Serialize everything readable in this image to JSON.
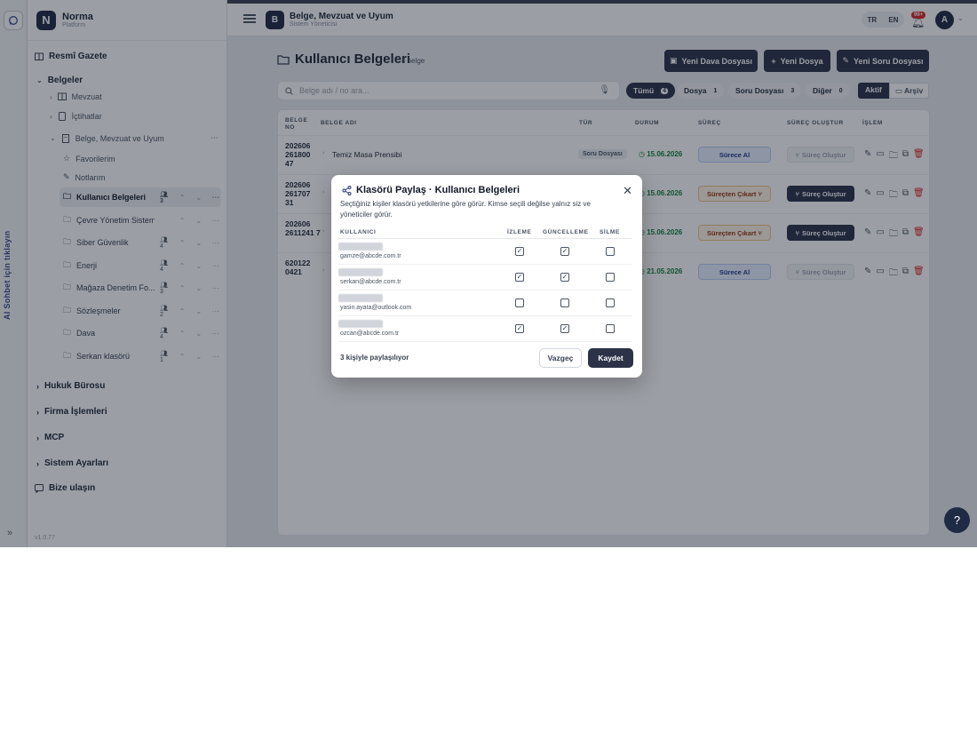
{
  "rail": {
    "vertical_label": "AI Sohbet için tıklayın"
  },
  "brand": {
    "logo": "N",
    "name": "Norma",
    "sub": "Platform"
  },
  "sidebar": {
    "resmi_gazete": "Resmî Gazete",
    "belgeler": "Belgeler",
    "sub_items": [
      {
        "label": "Mevzuat",
        "icon": "book-icon"
      },
      {
        "label": "İçtihatlar",
        "icon": "doc-icon"
      },
      {
        "label": "Belge, Mevzuat ve Uyum",
        "icon": "building-icon"
      }
    ],
    "favorilerim": "Favorilerim",
    "notlarim": "Notlarım",
    "folders": [
      {
        "name": "Kullanıcı Belgeleri",
        "count": "3"
      },
      {
        "name": "Çevre Yönetim Sistemleri",
        "count": ""
      },
      {
        "name": "Siber Güvenlik",
        "count": "4"
      },
      {
        "name": "Enerji",
        "count": "4"
      },
      {
        "name": "Mağaza Denetim Fo...",
        "count": "3"
      },
      {
        "name": "Sözleşmeler",
        "count": "2"
      },
      {
        "name": "Dava",
        "count": "4"
      },
      {
        "name": "Serkan klasörü",
        "count": "1"
      }
    ],
    "sections": [
      "Hukuk Bürosu",
      "Firma İşlemleri",
      "MCP",
      "Sistem Ayarları"
    ],
    "bize_ulasin": "Bize ulaşın",
    "version": "v1.0.77"
  },
  "topbar": {
    "badge": "B",
    "title": "Belge, Mevzuat ve Uyum",
    "subtitle": "Sistem Yöneticisi",
    "lang_tr": "TR",
    "lang_en": "EN",
    "notif_count": "99+",
    "avatar": "A"
  },
  "main": {
    "title": "Kullanıcı Belgeleri",
    "count": "4 belge",
    "btn_dava": "Yeni Dava Dosyası",
    "btn_dosya": "Yeni Dosya",
    "btn_soru": "Yeni Soru Dosyası",
    "search_placeholder": "Belge adı / no ara...",
    "chips": [
      {
        "label": "Tümü",
        "num": "4"
      },
      {
        "label": "Dosya",
        "num": "1"
      },
      {
        "label": "Soru Dosyası",
        "num": "3"
      },
      {
        "label": "Diğer",
        "num": "0"
      }
    ],
    "seg_aktif": "Aktif",
    "seg_arsiv": "Arşiv"
  },
  "table": {
    "headers": {
      "no": "BELGE NO",
      "ad": "BELGE ADI",
      "tur": "TÜR",
      "durum": "DURUM",
      "surec": "SÜREÇ",
      "olustur": "SÜREÇ OLUŞTUR",
      "islem": "İŞLEM"
    },
    "rows": [
      {
        "no": "202606 261800 47",
        "name": "Temiz Masa Prensibi",
        "type": "Soru Dosyası",
        "date": "15.06.2026",
        "surec": "Sürece Al",
        "olustur": "Süreç Oluştur"
      },
      {
        "no": "202606 261707 31",
        "name": "",
        "type": "",
        "date": "15.06.2026",
        "surec": "Süreçten Çıkart",
        "olustur": "Süreç Oluştur"
      },
      {
        "no": "202606 2611241 7",
        "name": "",
        "type": "",
        "date": "15.06.2026",
        "surec": "Süreçten Çıkart",
        "olustur": "Süreç Oluştur"
      },
      {
        "no": "620122 0421",
        "name": "",
        "type": "",
        "date": "21.05.2026",
        "surec": "Sürece Al",
        "olustur": "Süreç Oluştur"
      }
    ]
  },
  "modal": {
    "title": "Klasörü Paylaş · Kullanıcı Belgeleri",
    "desc": "Seçtiğiniz kişiler klasörü yetkilerine göre görür. Kimse seçili değilse yalnız siz ve yöneticiler görür.",
    "headers": {
      "user": "KULLANICI",
      "view": "İZLEME",
      "update": "GÜNCELLEME",
      "delete": "SİLME"
    },
    "users": [
      {
        "email": "gamze@abcde.com.tr",
        "view": true,
        "update": true,
        "delete": false
      },
      {
        "email": "serkan@abcde.com.tr",
        "view": true,
        "update": true,
        "delete": false
      },
      {
        "email": "yasin.ayata@outlook.com",
        "view": false,
        "update": false,
        "delete": false
      },
      {
        "email": "ozcan@abcde.com.tr",
        "view": true,
        "update": true,
        "delete": false
      }
    ],
    "footer": "3 kişiyle paylaşılıyor",
    "cancel": "Vazgeç",
    "save": "Kaydet"
  }
}
